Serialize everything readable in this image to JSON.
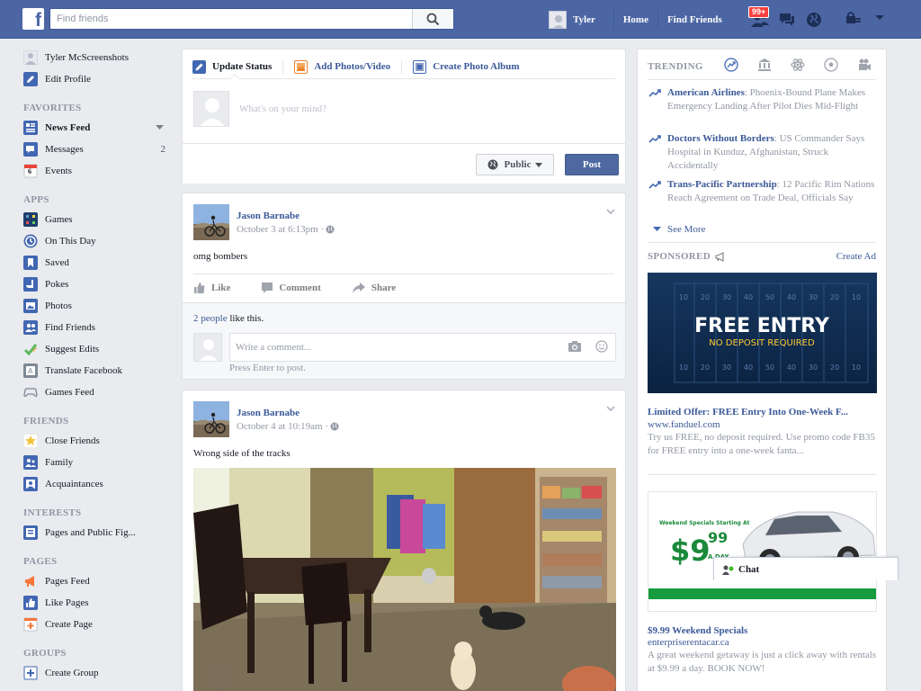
{
  "topbar": {
    "logo": "f",
    "search_placeholder": "Find friends",
    "user_name": "Tyler",
    "links": [
      "Home",
      "Find Friends"
    ],
    "friend_requests_badge": "99+"
  },
  "leftnav": {
    "profile": [
      {
        "label": "Tyler McScreenshots",
        "icon": "avatar"
      },
      {
        "label": "Edit Profile",
        "icon": "pencil-icon"
      }
    ],
    "favorites_heading": "FAVORITES",
    "favorites": [
      {
        "label": "News Feed",
        "icon": "news-feed-icon",
        "bold": true
      },
      {
        "label": "Messages",
        "icon": "messages-icon",
        "count": "2"
      },
      {
        "label": "Events",
        "icon": "calendar-icon",
        "icon_text": "6"
      }
    ],
    "apps_heading": "APPS",
    "apps": [
      {
        "label": "Games",
        "icon": "games-icon"
      },
      {
        "label": "On This Day",
        "icon": "clock-icon"
      },
      {
        "label": "Saved",
        "icon": "bookmark-icon"
      },
      {
        "label": "Pokes",
        "icon": "poke-icon"
      },
      {
        "label": "Photos",
        "icon": "photos-icon"
      },
      {
        "label": "Find Friends",
        "icon": "find-friends-icon"
      },
      {
        "label": "Suggest Edits",
        "icon": "suggest-edits-icon"
      },
      {
        "label": "Translate Facebook",
        "icon": "translate-icon"
      },
      {
        "label": "Games Feed",
        "icon": "gamepad-icon"
      }
    ],
    "friends_heading": "FRIENDS",
    "friends": [
      {
        "label": "Close Friends",
        "icon": "star-icon"
      },
      {
        "label": "Family",
        "icon": "family-icon"
      },
      {
        "label": "Acquaintances",
        "icon": "acquaintances-icon"
      }
    ],
    "interests_heading": "INTERESTS",
    "interests": [
      {
        "label": "Pages and Public Fig...",
        "icon": "pages-list-icon"
      }
    ],
    "pages_heading": "PAGES",
    "pages": [
      {
        "label": "Pages Feed",
        "icon": "megaphone-icon"
      },
      {
        "label": "Like Pages",
        "icon": "thumbs-up-icon"
      },
      {
        "label": "Create Page",
        "icon": "create-page-icon"
      }
    ],
    "groups_heading": "GROUPS",
    "groups": [
      {
        "label": "Create Group",
        "icon": "plus-icon"
      }
    ]
  },
  "composer": {
    "tabs": [
      "Update Status",
      "Add Photos/Video",
      "Create Photo Album"
    ],
    "placeholder": "What's on your mind?",
    "audience": "Public",
    "post_label": "Post"
  },
  "posts": [
    {
      "author": "Jason Barnabe",
      "time": "October 3 at 6:13pm · ",
      "text": "omg bombers",
      "actions": [
        "Like",
        "Comment",
        "Share"
      ],
      "likes_link": "2 people",
      "likes_suffix": " like this.",
      "comment_placeholder": "Write a comment...",
      "comment_hint": "Press Enter to post."
    },
    {
      "author": "Jason Barnabe",
      "time": "October 4 at 10:19am · ",
      "text": "Wrong side of the tracks"
    }
  ],
  "rightcol": {
    "trending_heading": "TRENDING",
    "trending": [
      {
        "topic": "American Airlines",
        "desc": ": Phoenix-Bound Plane Makes Emergency Landing After Pilot Dies Mid-Flight"
      },
      {
        "topic": "Doctors Without Borders",
        "desc": ": US Commander Says Hospital in Kunduz, Afghanistan, Struck Accidentally"
      },
      {
        "topic": "Trans-Pacific Partnership",
        "desc": ": 12 Pacific Rim Nations Reach Agreement on Trade Deal, Officials Say"
      }
    ],
    "see_more": "See More",
    "sponsored_heading": "SPONSORED",
    "create_ad": "Create Ad",
    "ads": [
      {
        "image_title": "FREE ENTRY",
        "image_sub": "NO DEPOSIT REQUIRED",
        "yard_marks": [
          "10",
          "20",
          "30",
          "40",
          "50",
          "40",
          "30",
          "20",
          "10"
        ],
        "title": "Limited Offer: FREE Entry Into One-Week F...",
        "url": "www.fanduel.com",
        "desc": "Try us FREE, no deposit required. Use promo code FB35 for FREE entry into a one-week fanta..."
      },
      {
        "image_top": "Weekend Specials Starting At",
        "image_price": "$9",
        "image_cents": "99",
        "image_per": "A DAY",
        "title": "$9.99 Weekend Specials",
        "url": "enterpriserentacar.ca",
        "desc": "A great weekend getaway is just a click away with rentals at $9.99 a day. BOOK NOW!"
      }
    ]
  },
  "chat": {
    "label": "Chat"
  }
}
